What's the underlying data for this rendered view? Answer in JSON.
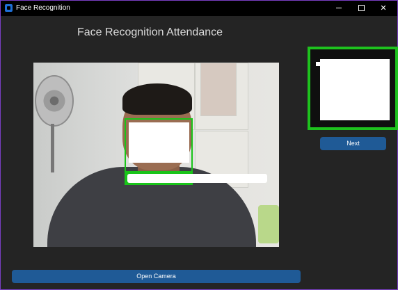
{
  "window": {
    "title": "Face Recognition",
    "controls": {
      "minimize": "",
      "maximize": "",
      "close": "✕"
    },
    "border_color": "#7a3fc4"
  },
  "main": {
    "heading": "Face Recognition Attendance"
  },
  "buttons": {
    "next_label": "Next",
    "open_camera_label": "Open Camera",
    "color": "#1f5a96"
  },
  "detection": {
    "box_color": "#19c419"
  },
  "icons": {
    "app": "app-icon",
    "minimize": "minimize-icon",
    "maximize": "maximize-icon",
    "close": "close-icon"
  }
}
